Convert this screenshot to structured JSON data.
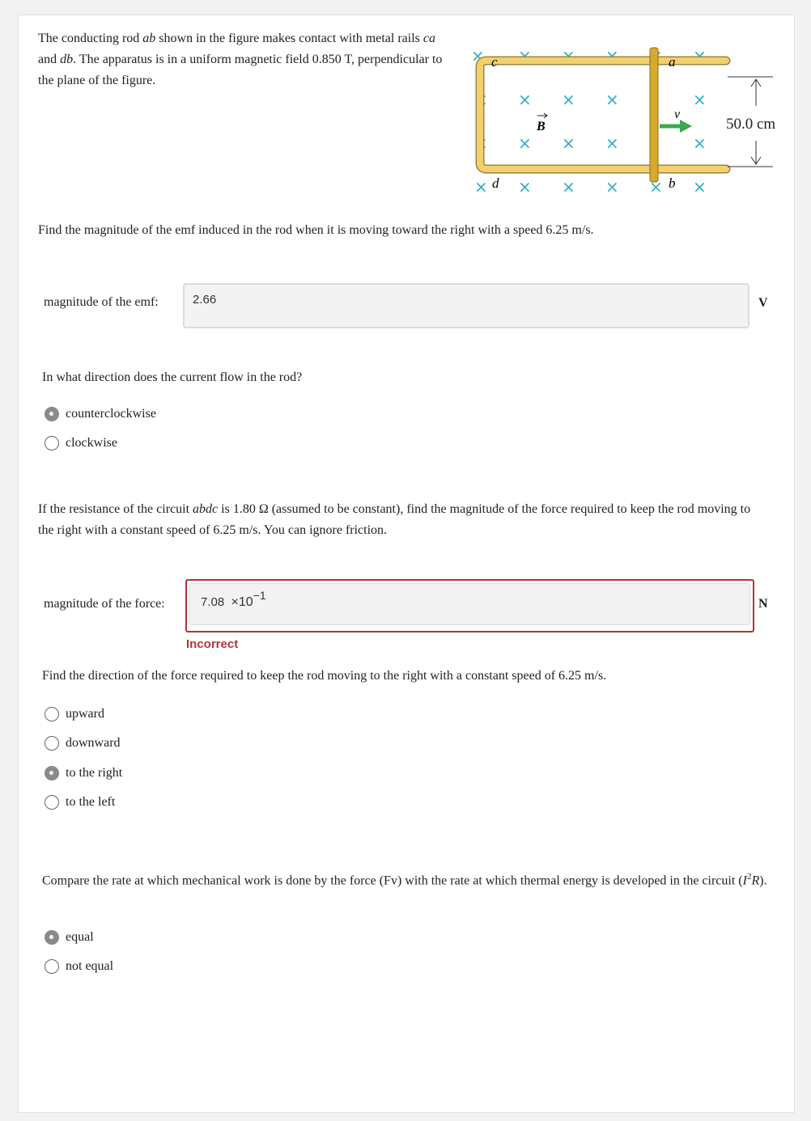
{
  "intro": {
    "t1": "The conducting rod ",
    "rod": "ab",
    "t2": " shown in the figure makes contact with metal rails ",
    "rail1": "ca",
    "t3": " and ",
    "rail2": "db",
    "t4": ". The apparatus is in a uniform magnetic field 0.850 T, perpendicular to the plane of the figure."
  },
  "figure": {
    "label_c": "c",
    "label_a": "a",
    "label_d": "d",
    "label_b": "b",
    "label_B": "B",
    "label_v": "v",
    "dimension": "50.0 cm",
    "field_symbol": "×",
    "colors": {
      "field": "#2bb1c6",
      "rail": "#f2d06e",
      "rail_edge": "#9a8440",
      "arrow": "#3aa84d",
      "rod": "#d7a92c"
    }
  },
  "q1": {
    "text": "Find the magnitude of the emf induced in the rod when it is moving toward the right with a speed 6.25 m/s.",
    "label": "magnitude of the emf:",
    "value": "2.66",
    "unit": "V"
  },
  "q2": {
    "text": "In what direction does the current flow in the rod?",
    "options": [
      {
        "label": "counterclockwise",
        "checked": true
      },
      {
        "label": "clockwise",
        "checked": false
      }
    ]
  },
  "q3": {
    "t1": "If the resistance of the circuit ",
    "circuit": "abdc",
    "t2": " is 1.80 Ω  (assumed to be constant), find the magnitude of the force required to keep the rod moving to the right with a constant speed of 6.25 m/s.  You can ignore friction.",
    "label": "magnitude of the force:",
    "value_mantissa": "7.08",
    "value_times": "×10",
    "value_exp": "−1",
    "unit": "N",
    "feedback": "Incorrect"
  },
  "q4": {
    "text": "Find the direction of the force required to keep the rod moving to the right with a constant speed of 6.25 m/s.",
    "options": [
      {
        "label": "upward",
        "checked": false
      },
      {
        "label": "downward",
        "checked": false
      },
      {
        "label": "to the right",
        "checked": true
      },
      {
        "label": "to the left",
        "checked": false
      }
    ]
  },
  "q5": {
    "t1": "Compare the rate at which mechanical work is done by the force (Fv) with the rate at which thermal energy is developed in the circuit (",
    "I": "I",
    "sup": "2",
    "R": "R",
    "t2": ").",
    "options": [
      {
        "label": "equal",
        "checked": true
      },
      {
        "label": "not equal",
        "checked": false
      }
    ]
  }
}
